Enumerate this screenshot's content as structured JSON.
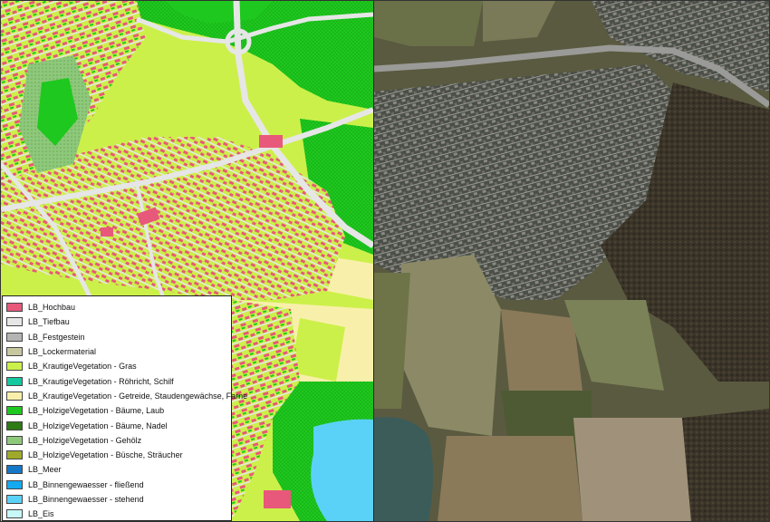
{
  "legend": {
    "items": [
      {
        "label": "LB_Hochbau",
        "color": "#e8587a"
      },
      {
        "label": "LB_Tiefbau",
        "color": "#e6e6e6"
      },
      {
        "label": "LB_Festgestein",
        "color": "#b4b4b4"
      },
      {
        "label": "LB_Lockermaterial",
        "color": "#c8c8a0"
      },
      {
        "label": "LB_KrautigeVegetation - Gras",
        "color": "#ccf04a"
      },
      {
        "label": "LB_KrautigeVegetation - Röhricht, Schilf",
        "color": "#14c8a0"
      },
      {
        "label": "LB_KrautigeVegetation - Getreide, Staudengewächse, Farne",
        "color": "#f8f0aa"
      },
      {
        "label": "LB_HolzigeVegetation - Bäume, Laub",
        "color": "#1ec81e"
      },
      {
        "label": "LB_HolzigeVegetation - Bäume, Nadel",
        "color": "#2e7a14"
      },
      {
        "label": "LB_HolzigeVegetation - Gehölz",
        "color": "#8ec87a"
      },
      {
        "label": "LB_HolzigeVegetation - Büsche, Sträucher",
        "color": "#a0aa2a"
      },
      {
        "label": "LB_Meer",
        "color": "#1478c8"
      },
      {
        "label": "LB_Binnengewaesser - fließend",
        "color": "#14aaf0"
      },
      {
        "label": "LB_Binnengewaesser - stehend",
        "color": "#5ad2f8"
      },
      {
        "label": "LB_Eis",
        "color": "#c8f8f8"
      }
    ]
  }
}
